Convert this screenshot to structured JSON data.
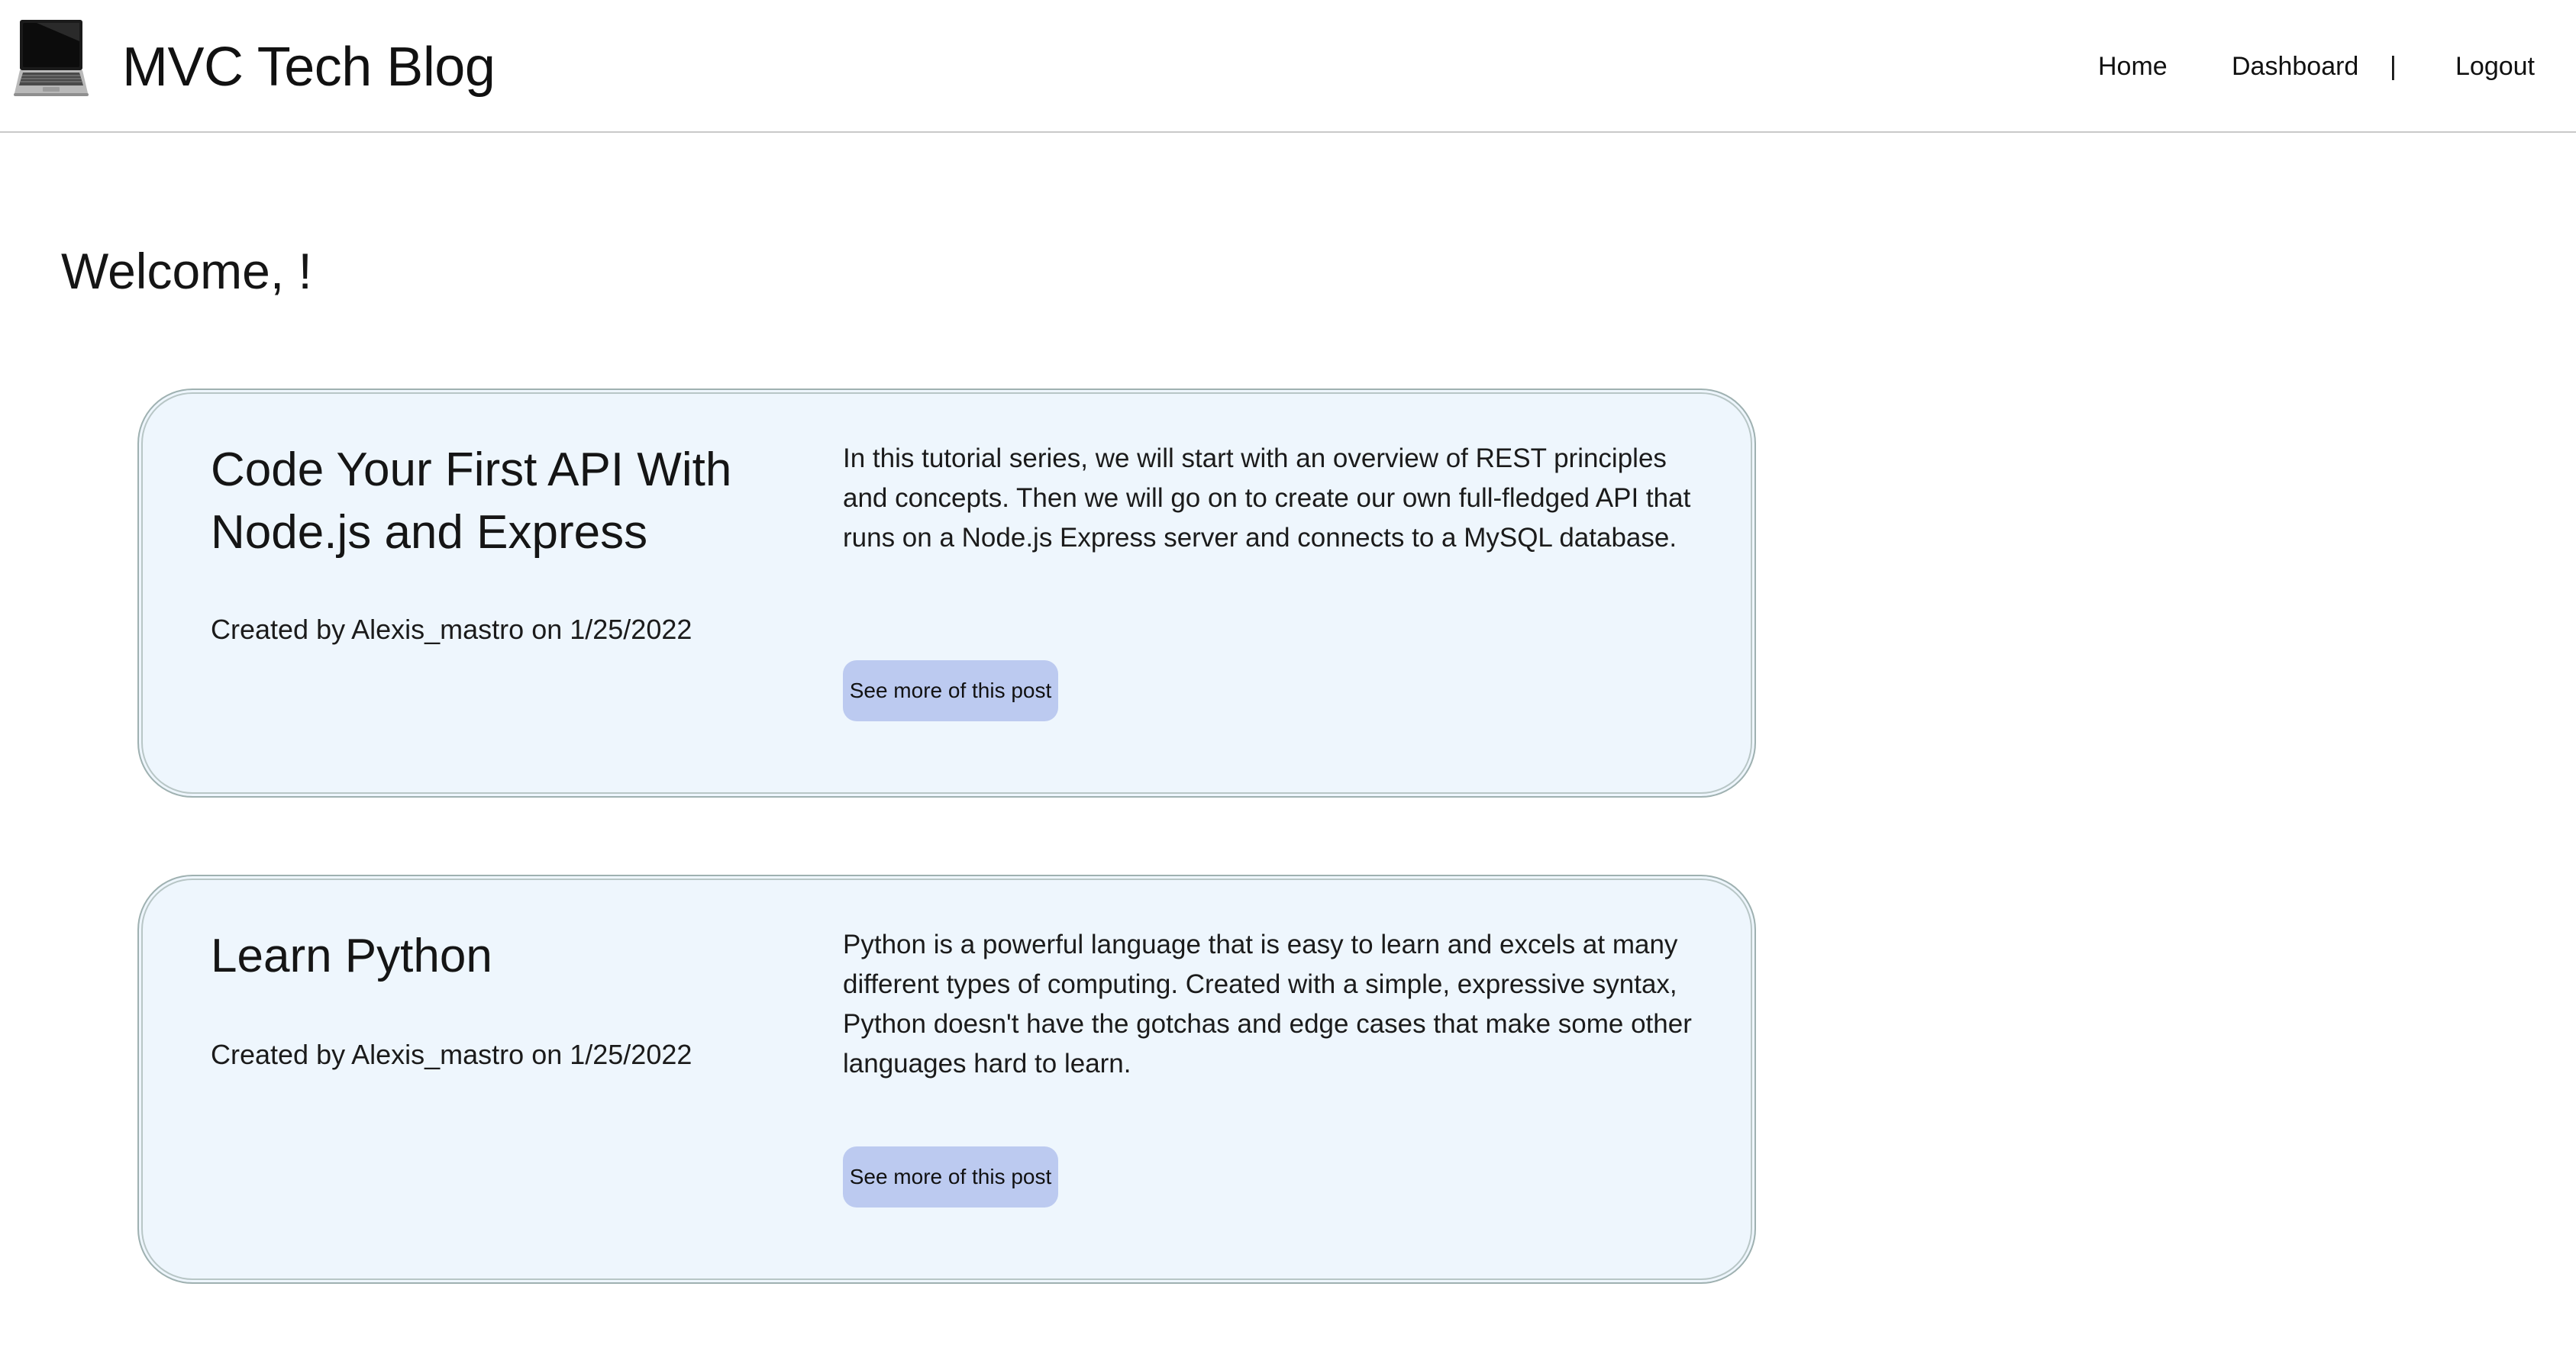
{
  "header": {
    "logo_icon": "laptop-icon",
    "title": "MVC Tech Blog",
    "nav": {
      "home": "Home",
      "dashboard": "Dashboard",
      "separator": "|",
      "logout": "Logout"
    }
  },
  "main": {
    "welcome": "Welcome, !",
    "posts": [
      {
        "title": "Code Your First API With Node.js and Express",
        "meta": "Created by Alexis_mastro on 1/25/2022",
        "body": "In this tutorial series, we will start with an overview of REST principles and concepts. Then we will go on to create our own full-fledged API that runs on a Node.js Express server and connects to a MySQL database.",
        "button": "See more of this post"
      },
      {
        "title": "Learn Python",
        "meta": "Created by Alexis_mastro on 1/25/2022",
        "body": "Python is a powerful language that is easy to learn and excels at many different types of computing. Created with a simple, expressive syntax, Python doesn't have the gotchas and edge cases that make some other languages hard to learn.",
        "button": "See more of this post"
      }
    ]
  },
  "colors": {
    "card_background": "#eef6fd",
    "card_border": "#9fb1b1",
    "button_background": "#bccaf0"
  }
}
